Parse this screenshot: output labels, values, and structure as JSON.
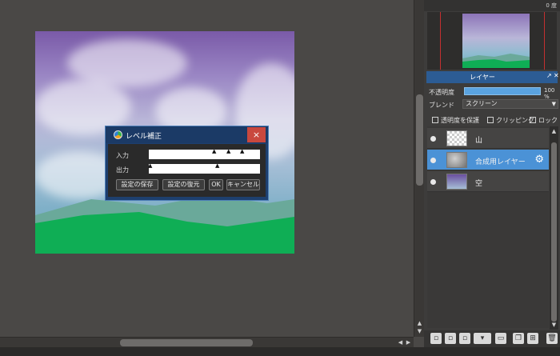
{
  "dialog": {
    "title": "レベル補正",
    "close": "×",
    "input_label": "入力",
    "output_label": "出力",
    "buttons": {
      "save": "設定の保存",
      "restore": "設定の復元",
      "ok": "OK",
      "cancel": "キャンセル"
    }
  },
  "icons": {
    "close": "close-icon",
    "triangle": "slider-triangle-icon",
    "gear": "gear-icon",
    "eye": "eye-icon"
  },
  "topstrip": {
    "value": "0 度"
  },
  "layer_panel": {
    "title": "レイヤー",
    "opacity_label": "不透明度",
    "opacity_value": "100 %",
    "blend_label": "ブレンド",
    "blend_value": "スクリーン",
    "checkbox_protect": "透明度を保護",
    "checkbox_clipping": "クリッピング",
    "checkbox_lock": "ロック",
    "layers": [
      {
        "name": "山",
        "selected": false
      },
      {
        "name": "合成用レイヤー",
        "selected": true
      },
      {
        "name": "空",
        "selected": false
      }
    ]
  },
  "colors": {
    "accent": "#4b92d6",
    "dialog": "#1d3f6e",
    "close": "#c9483e",
    "grass": "#0fae55"
  }
}
